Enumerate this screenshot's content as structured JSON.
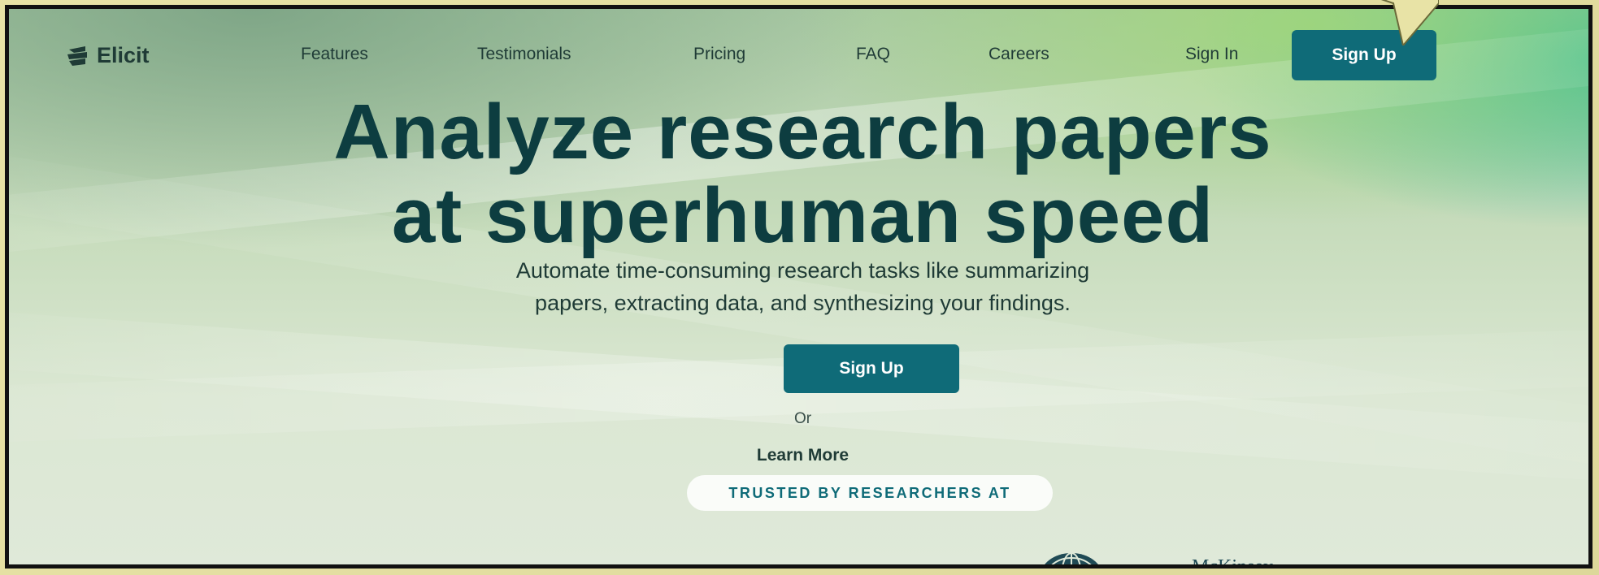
{
  "brand": {
    "name": "Elicit",
    "icon": "elicit-logo-icon"
  },
  "nav": {
    "links": [
      "Features",
      "Testimonials",
      "Pricing",
      "FAQ",
      "Careers"
    ],
    "sign_in": "Sign In",
    "sign_up": "Sign Up"
  },
  "hero": {
    "title_line1": "Analyze research papers",
    "title_line2": "at superhuman speed",
    "subtitle_line1": "Automate time-consuming research tasks like summarizing",
    "subtitle_line2": "papers, extracting data, and synthesizing your findings.",
    "cta_sign_up": "Sign Up",
    "or_text": "Or",
    "learn_more": "Learn More",
    "trusted_badge": "TRUSTED BY RESEARCHERS AT"
  },
  "partners": {
    "partner3_text": "McKinsey"
  },
  "colors": {
    "primary_button": "#0f6b78",
    "heading": "#0d3d40",
    "text": "#1f3b36",
    "frame": "#e8e3a6"
  }
}
